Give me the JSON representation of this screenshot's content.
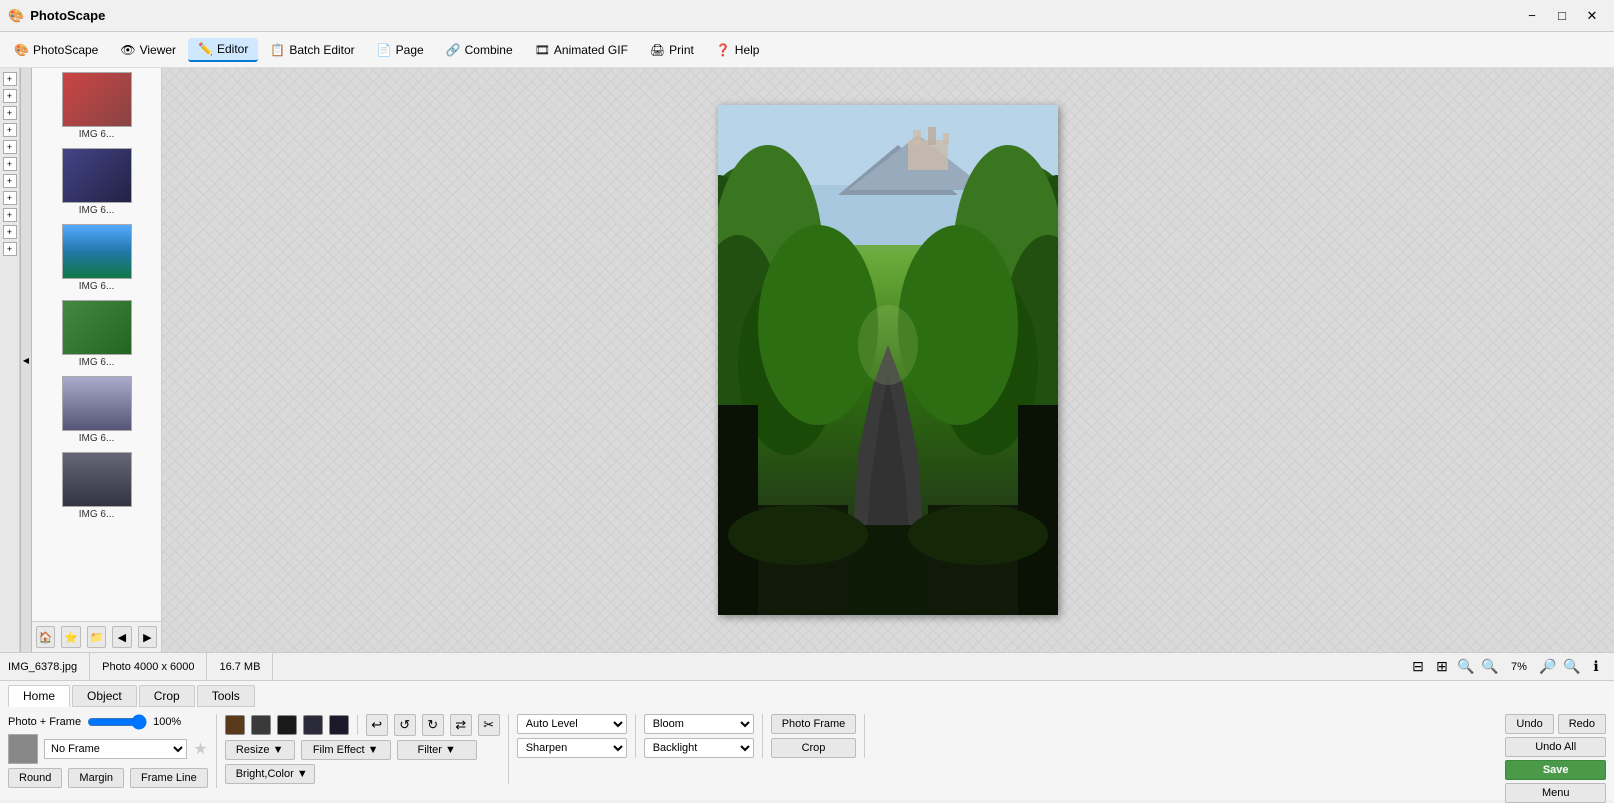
{
  "app": {
    "title": "PhotoScape",
    "icon": "🎨"
  },
  "titlebar": {
    "minimize": "−",
    "maximize": "□",
    "close": "✕"
  },
  "menubar": {
    "items": [
      {
        "id": "photoscape",
        "label": "PhotoScape",
        "icon": "🎨"
      },
      {
        "id": "viewer",
        "label": "Viewer",
        "icon": "👁"
      },
      {
        "id": "editor",
        "label": "Editor",
        "icon": "✏️",
        "active": true
      },
      {
        "id": "batch",
        "label": "Batch Editor",
        "icon": "📋"
      },
      {
        "id": "page",
        "label": "Page",
        "icon": "📄"
      },
      {
        "id": "combine",
        "label": "Combine",
        "icon": "🔗"
      },
      {
        "id": "gif",
        "label": "Animated GIF",
        "icon": "🎞"
      },
      {
        "id": "print",
        "label": "Print",
        "icon": "🖨"
      },
      {
        "id": "help",
        "label": "Help",
        "icon": "❓"
      }
    ]
  },
  "statusbar": {
    "filename": "IMG_6378.jpg",
    "dimensions": "Photo 4000 x 6000",
    "filesize": "16.7 MB",
    "zoom_level": "7%"
  },
  "thumbnails": [
    {
      "id": "img1",
      "label": "IMG 6...",
      "color": "thumb-red"
    },
    {
      "id": "img2",
      "label": "IMG 6...",
      "color": "thumb-blue"
    },
    {
      "id": "img3",
      "label": "IMG 6...",
      "color": "thumb-lake"
    },
    {
      "id": "img4",
      "label": "IMG 6...",
      "color": "thumb-green"
    },
    {
      "id": "img5",
      "label": "IMG 6...",
      "color": "thumb-portrait"
    }
  ],
  "toolbar": {
    "tabs": [
      {
        "id": "home",
        "label": "Home",
        "active": true
      },
      {
        "id": "object",
        "label": "Object"
      },
      {
        "id": "crop",
        "label": "Crop"
      },
      {
        "id": "tools",
        "label": "Tools"
      }
    ],
    "photo_frame_label": "Photo + Frame",
    "slider_value": "100%",
    "frame_label": "No Frame",
    "star_char": "★",
    "color_swatches": [
      "#5a3a1a",
      "#3a3a3a",
      "#1a1a1a",
      "#2a2a3a",
      "#1a1a2a"
    ],
    "icon_buttons": [
      "↩",
      "↺",
      "↻",
      "⇄",
      "✂"
    ],
    "buttons_row1": {
      "resize": "Resize",
      "bright_color": "Bright,Color"
    },
    "dropdowns_row1": {
      "auto_level": "Auto Level",
      "sharpen": "Sharpen",
      "film_effect": "Film Effect",
      "filter": "Filter"
    },
    "dropdowns_row2": {
      "bloom": "Bloom",
      "backlight": "Backlight"
    },
    "bottom_buttons": {
      "round": "Round",
      "margin": "Margin",
      "frame_line": "Frame Line",
      "photo_frame": "Photo Frame",
      "crop": "Crop"
    },
    "undo": "Undo",
    "redo": "Redo",
    "undo_all": "Undo All",
    "save": "Save",
    "menu": "Menu"
  },
  "tree_items": [
    {},
    {},
    {},
    {},
    {},
    {},
    {},
    {},
    {},
    {},
    {}
  ]
}
